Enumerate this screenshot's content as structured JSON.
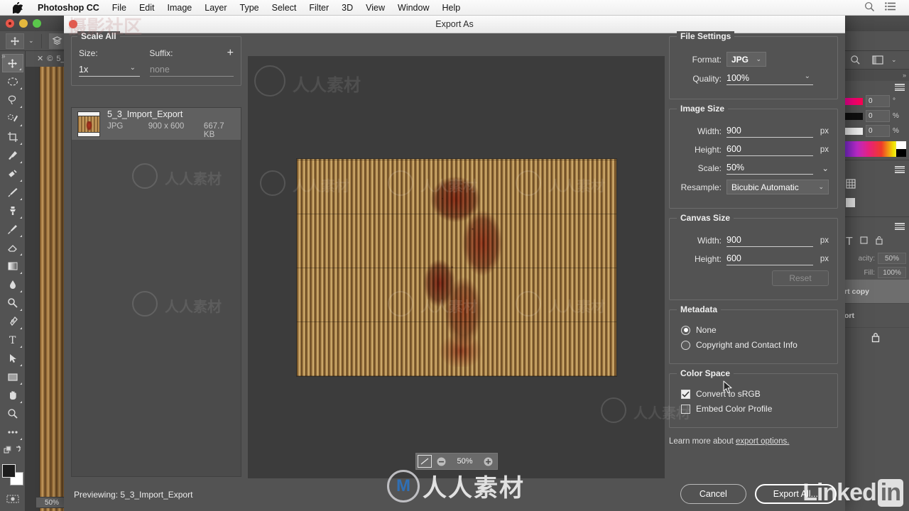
{
  "menubar": {
    "apple_icon": "apple-logo",
    "items": [
      {
        "label": "Photoshop CC",
        "bold": true
      },
      {
        "label": "File",
        "bold": false
      },
      {
        "label": "Edit",
        "bold": false
      },
      {
        "label": "Image",
        "bold": false
      },
      {
        "label": "Layer",
        "bold": false
      },
      {
        "label": "Type",
        "bold": false
      },
      {
        "label": "Select",
        "bold": false
      },
      {
        "label": "Filter",
        "bold": false
      },
      {
        "label": "3D",
        "bold": false
      },
      {
        "label": "View",
        "bold": false
      },
      {
        "label": "Window",
        "bold": false
      },
      {
        "label": "Help",
        "bold": false
      }
    ],
    "right_icons": [
      "search-icon",
      "list-icon"
    ]
  },
  "photoshop": {
    "document_tab": "5_",
    "zoom_badge": "50%",
    "toolbar_icons": [
      "move-tool-icon",
      "marquee-tool-icon",
      "lasso-tool-icon",
      "quick-selection-tool-icon",
      "crop-tool-icon",
      "eyedropper-tool-icon",
      "healing-brush-tool-icon",
      "brush-tool-icon",
      "clone-stamp-tool-icon",
      "history-brush-tool-icon",
      "eraser-tool-icon",
      "gradient-tool-icon",
      "blur-tool-icon",
      "dodge-tool-icon",
      "pen-tool-icon",
      "type-tool-icon",
      "path-selection-tool-icon",
      "rectangle-tool-icon",
      "hand-tool-icon",
      "zoom-tool-icon",
      "more-tools-icon"
    ],
    "color_panel": {
      "hue": "0",
      "hue_unit": "°",
      "saturation": "0",
      "saturation_unit": "%",
      "brightness": "0",
      "brightness_unit": "%"
    },
    "layers_panel": {
      "opacity_label": "acity:",
      "opacity_value": "50%",
      "fill_label": "Fill:",
      "fill_value": "100%",
      "layers": [
        "rt copy",
        "ort"
      ]
    }
  },
  "dialog": {
    "title": "Export As",
    "scale_all": {
      "legend": "Scale All",
      "size_label": "Size:",
      "size_value": "1x",
      "suffix_label": "Suffix:",
      "suffix_placeholder": "none",
      "add_button": "+"
    },
    "asset": {
      "name": "5_3_Import_Export",
      "format": "JPG",
      "dimensions": "900 x 600",
      "filesize": "667.7 KB"
    },
    "previewing_label": "Previewing: 5_3_Import_Export",
    "preview_zoom": {
      "fit_icon": "fit-screen-icon",
      "minus": "−",
      "level": "50%",
      "plus": "+"
    },
    "file_settings": {
      "legend": "File Settings",
      "format_label": "Format:",
      "format_value": "JPG",
      "quality_label": "Quality:",
      "quality_value": "100%"
    },
    "image_size": {
      "legend": "Image Size",
      "width_label": "Width:",
      "width_value": "900",
      "width_unit": "px",
      "height_label": "Height:",
      "height_value": "600",
      "height_unit": "px",
      "scale_label": "Scale:",
      "scale_value": "50%",
      "resample_label": "Resample:",
      "resample_value": "Bicubic Automatic"
    },
    "canvas_size": {
      "legend": "Canvas Size",
      "width_label": "Width:",
      "width_value": "900",
      "width_unit": "px",
      "height_label": "Height:",
      "height_value": "600",
      "height_unit": "px",
      "reset_label": "Reset"
    },
    "metadata": {
      "legend": "Metadata",
      "option_none": "None",
      "option_copyright": "Copyright and Contact Info",
      "selected": "None"
    },
    "color_space": {
      "legend": "Color Space",
      "convert_srgb": "Convert to sRGB",
      "convert_srgb_checked": true,
      "embed_profile": "Embed Color Profile",
      "embed_profile_checked": false
    },
    "learn_more": {
      "prefix": "Learn more about ",
      "link": "export options."
    },
    "buttons": {
      "cancel": "Cancel",
      "export_all": "Export All..."
    }
  },
  "watermarks": {
    "linkedin_text": "Linked",
    "linkedin_box": "in",
    "center_cn": "人人素材",
    "center_logo": "M",
    "top_left_cn": "摄影社区"
  },
  "colors": {
    "panel_bg": "#535353",
    "canvas_bg": "#3c3c3c",
    "text": "#f0f0f0",
    "accent_red": "#e8574a",
    "field_underline": "#cdcdcd"
  }
}
